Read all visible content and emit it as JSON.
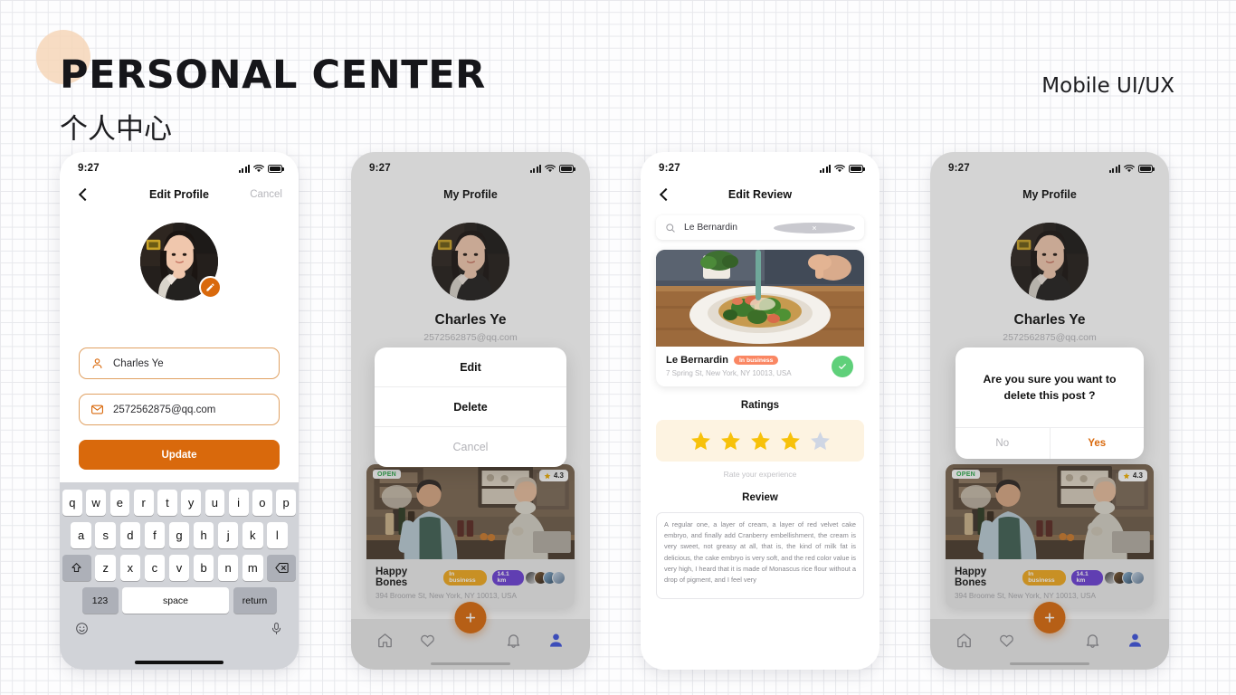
{
  "poster": {
    "title": "PERSONAL CENTER",
    "subtitle": "个人中心",
    "tag": "Mobile UI/UX",
    "accent_color": "#d9690c",
    "blob_color": "#f6d6b8"
  },
  "status_bar": {
    "time": "9:27"
  },
  "screens": {
    "edit_profile": {
      "nav_title": "Edit Profile",
      "cancel_label": "Cancel",
      "name_field": {
        "value": "Charles Ye",
        "icon": "user-icon"
      },
      "email_field": {
        "value": "2572562875@qq.com",
        "icon": "mail-icon"
      },
      "update_button": "Update",
      "edit_avatar_icon": "pencil-icon"
    },
    "my_profile": {
      "nav_title": "My Profile",
      "name": "Charles Ye",
      "email": "2572562875@qq.com"
    },
    "action_sheet": {
      "items": [
        "Edit",
        "Delete"
      ],
      "cancel": "Cancel"
    },
    "delete_dialog": {
      "message": "Are you sure you want to delete this post ?",
      "no_label": "No",
      "yes_label": "Yes"
    },
    "edit_review": {
      "nav_title": "Edit Review",
      "search": {
        "value": "Le Bernardin",
        "icon": "search-icon",
        "clear_icon": "close-icon"
      },
      "place": {
        "name": "Le Bernardin",
        "badge": "In business",
        "badge_color": "#fa8763",
        "address": "7 Spring St, New York, NY 10013, USA",
        "selected_icon": "check-circle-icon"
      },
      "ratings_title": "Ratings",
      "rating_value": 4,
      "rating_max": 5,
      "rate_hint": "Rate your experience",
      "review_title": "Review",
      "review_text": "A regular one, a layer of cream, a layer of red velvet cake embryo, and finally add Cranberry embellishment, the cream is very sweet, not greasy at all, that is, the kind of milk fat is delicious, the cake embryo is very soft, and the red color value is very high, I heard that it is made of Monascus rice flour without a drop of pigment, and I feel very"
    }
  },
  "biz_card": {
    "open_badge": "OPEN",
    "rating": "4.3",
    "name": "Happy Bones",
    "chip_business": "In business",
    "chip_distance": "14.1 km",
    "address": "394 Broome St, New York, NY 10013, USA",
    "chip_business_color": "#f0a81e",
    "chip_distance_color": "#6b3fd4"
  },
  "tabbar": {
    "items": [
      {
        "name": "home",
        "icon": "home-icon",
        "active": false
      },
      {
        "name": "favorites",
        "icon": "heart-icon",
        "active": false
      },
      {
        "name": "notifications",
        "icon": "bell-icon",
        "active": false
      },
      {
        "name": "profile",
        "icon": "person-icon",
        "active": true
      }
    ],
    "fab_icon": "plus-icon",
    "active_color": "#3d52dd"
  },
  "keyboard": {
    "row1": [
      "q",
      "w",
      "e",
      "r",
      "t",
      "y",
      "u",
      "i",
      "o",
      "p"
    ],
    "row2": [
      "a",
      "s",
      "d",
      "f",
      "g",
      "h",
      "j",
      "k",
      "l"
    ],
    "row3": [
      "z",
      "x",
      "c",
      "v",
      "b",
      "n",
      "m"
    ],
    "shift_icon": "shift-icon",
    "backspace_icon": "backspace-icon",
    "numeric": "123",
    "space": "space",
    "return": "return",
    "emoji_icon": "emoji-icon",
    "mic_icon": "microphone-icon"
  }
}
